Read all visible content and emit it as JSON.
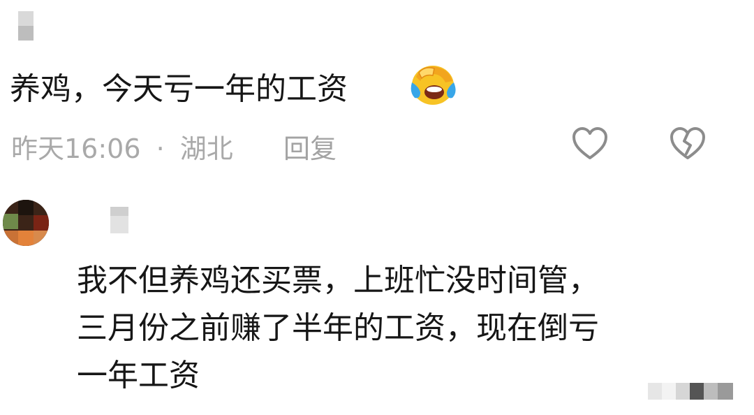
{
  "comments": [
    {
      "text": "养鸡，今天亏一年的工资",
      "emoji": "face-palm-crying-emoji",
      "time": "昨天16:06",
      "separator": "·",
      "location": "湖北",
      "reply_label": "回复",
      "like_icon": "heart-icon",
      "dislike_icon": "broken-heart-icon"
    },
    {
      "lines": [
        "我不但养鸡还买票，上班忙没时间管，",
        "三月份之前赚了半年的工资，现在倒亏",
        "一年工资"
      ]
    }
  ],
  "colors": {
    "text": "#161616",
    "meta": "#a9a9a9",
    "icon": "#8c8c8c",
    "emoji_yellow": "#f7c325",
    "emoji_tear": "#38a6e8"
  }
}
